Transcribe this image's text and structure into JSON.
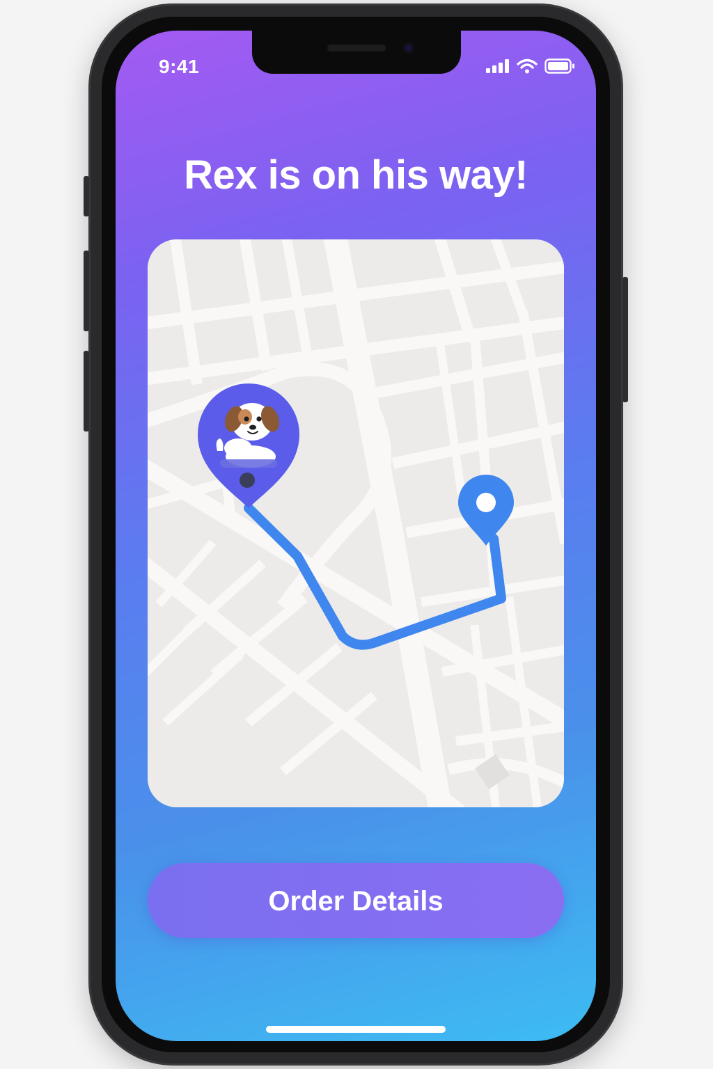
{
  "status_bar": {
    "time": "9:41",
    "signal_icon": "cellular-signal-icon",
    "wifi_icon": "wifi-icon",
    "battery_icon": "battery-icon"
  },
  "tracking": {
    "headline": "Rex is on his way!"
  },
  "map": {
    "courier_marker_icon": "dog-courier-marker-icon",
    "destination_marker_icon": "destination-pin-icon",
    "route_color": "#3f86ef",
    "marker_color": "#5b5ce9"
  },
  "actions": {
    "order_details_label": "Order Details"
  },
  "colors": {
    "gradient_top": "#a45af2",
    "gradient_bottom": "#3dbcf2",
    "button": "#7a6ff0"
  }
}
